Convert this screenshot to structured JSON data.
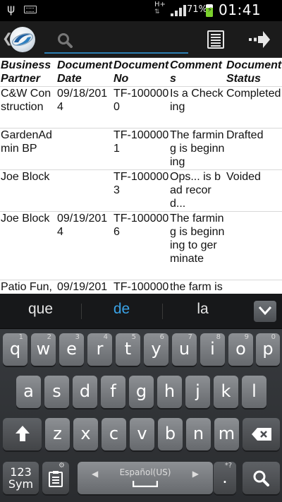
{
  "status_bar": {
    "network": "H+",
    "battery_percent": "71%",
    "time": "01:41 AM",
    "icons": [
      "usb-icon",
      "keyboard-icon",
      "signal-icon",
      "battery-charging-icon"
    ]
  },
  "action_bar": {
    "search_placeholder": "",
    "icons": [
      "back-chevron-icon",
      "app-logo-icon",
      "search-icon",
      "list-icon",
      "forward-arrow-icon"
    ]
  },
  "table": {
    "headers": [
      "Business Partner",
      "Document Date",
      "Document No",
      "Comments",
      "Document Status"
    ],
    "rows": [
      [
        "C&W Construction",
        "09/18/2014",
        "TF-1000000",
        "Is a Checking",
        "Completed"
      ],
      [
        "GardenAdmin BP",
        "",
        "TF-1000001",
        "The farming is beginning",
        "Drafted"
      ],
      [
        "Joe Block",
        "",
        "TF-1000003",
        "Ops... is bad record...",
        "Voided"
      ],
      [
        "Joe Block",
        "09/19/2014",
        "TF-1000006",
        "The farming is beginning to germinate",
        ""
      ],
      [
        "Patio Fun,",
        "09/19/201",
        "TF-100000",
        "the farm is",
        ""
      ]
    ]
  },
  "keyboard": {
    "suggestions": [
      "que",
      "de",
      "la"
    ],
    "row1": [
      {
        "key": "q",
        "hint": "1"
      },
      {
        "key": "w",
        "hint": "2"
      },
      {
        "key": "e",
        "hint": "3"
      },
      {
        "key": "r",
        "hint": "4"
      },
      {
        "key": "t",
        "hint": "5"
      },
      {
        "key": "y",
        "hint": "6"
      },
      {
        "key": "u",
        "hint": "7"
      },
      {
        "key": "i",
        "hint": "8"
      },
      {
        "key": "o",
        "hint": "9"
      },
      {
        "key": "p",
        "hint": "0"
      }
    ],
    "row2": [
      "a",
      "s",
      "d",
      "f",
      "g",
      "h",
      "j",
      "k",
      "l"
    ],
    "row3": [
      "z",
      "x",
      "c",
      "v",
      "b",
      "n",
      "m"
    ],
    "sym_line1": "123",
    "sym_line2": "Sym",
    "space_label": "Español(US)",
    "period": ".",
    "period_hint": "*?",
    "clipboard_hint": "⚙"
  },
  "colors": {
    "accent_blue": "#3aa2e6",
    "search_underline": "#2c7fb3",
    "battery_green": "#7bd12b"
  }
}
